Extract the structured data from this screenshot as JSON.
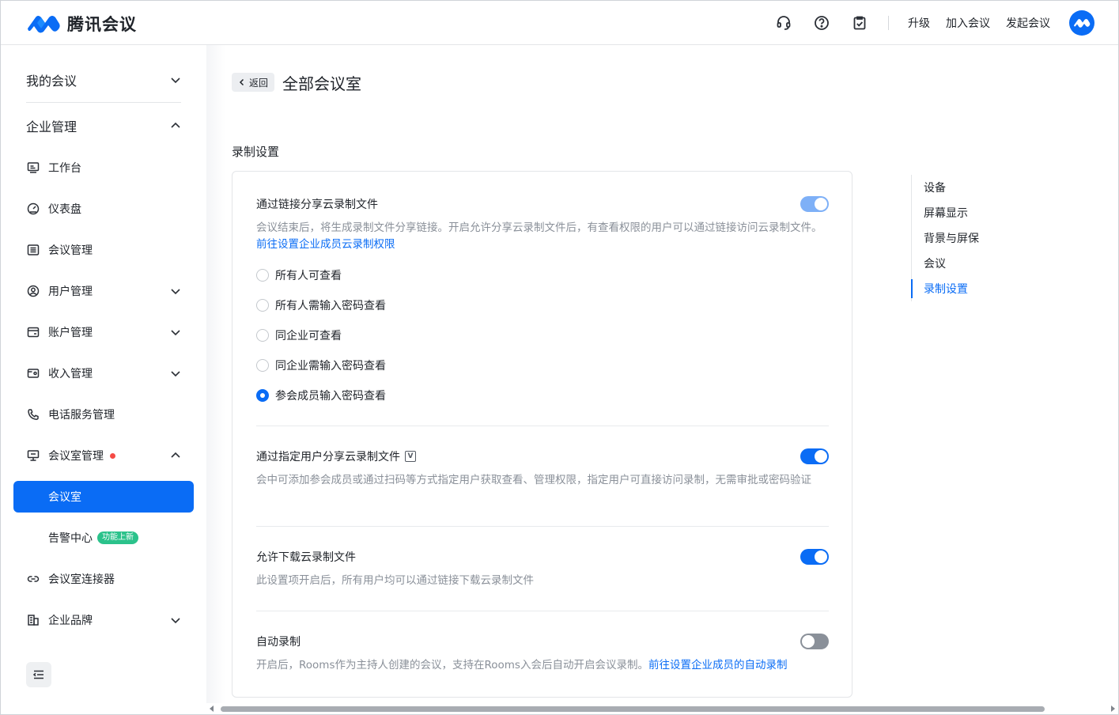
{
  "app": {
    "name": "腾讯会议"
  },
  "header": {
    "icons": [
      "headset-icon",
      "help-icon",
      "clipboard-check-icon"
    ],
    "links": {
      "upgrade": "升级",
      "join": "加入会议",
      "start": "发起会议"
    }
  },
  "sidebar": {
    "my_meetings": "我的会议",
    "enterprise": "企业管理",
    "items": {
      "workbench": "工作台",
      "dashboard": "仪表盘",
      "meeting_mgmt": "会议管理",
      "user_mgmt": "用户管理",
      "account_mgmt": "账户管理",
      "income_mgmt": "收入管理",
      "phone_mgmt": "电话服务管理",
      "room_mgmt": "会议室管理",
      "rooms": "会议室",
      "alert_center": "告警中心",
      "alert_badge": "功能上新",
      "connector": "会议室连接器",
      "brand": "企业品牌"
    }
  },
  "main": {
    "back": "返回",
    "title": "全部会议室",
    "section": "录制设置",
    "settings": {
      "link_share": {
        "title": "通过链接分享云录制文件",
        "desc": "会议结束后，将生成录制文件分享链接。开启允许分享云录制文件后，有查看权限的用户可以通过链接访问云录制文件。",
        "link": "前往设置企业成员云录制权限",
        "options": [
          "所有人可查看",
          "所有人需输入密码查看",
          "同企业可查看",
          "同企业需输入密码查看",
          "参会成员输入密码查看"
        ],
        "selected_index": 4
      },
      "user_share": {
        "title": "通过指定用户分享云录制文件",
        "desc": "会中可添加参会成员或通过扫码等方式指定用户获取查看、管理权限，指定用户可直接访问录制，无需审批或密码验证"
      },
      "download": {
        "title": "允许下载云录制文件",
        "desc": "此设置项开启后，所有用户均可以通过链接下载云录制文件"
      },
      "auto_record": {
        "title": "自动录制",
        "desc": "开启后，Rooms作为主持人创建的会议，支持在Rooms入会后自动开启会议录制。",
        "link": "前往设置企业成员的自动录制"
      }
    }
  },
  "anchor_nav": [
    "设备",
    "屏幕显示",
    "背景与屏保",
    "会议",
    "录制设置"
  ],
  "colors": {
    "accent": "#0a6cf5",
    "alert_dot": "#f54a45",
    "badge": "#2bc28b"
  }
}
